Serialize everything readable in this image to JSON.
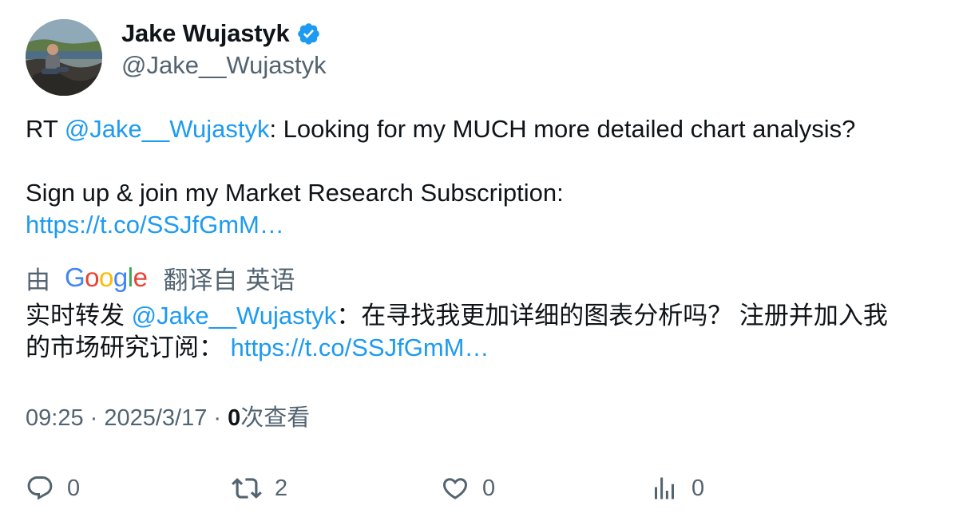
{
  "author": {
    "display_name": "Jake Wujastyk",
    "handle": "@Jake__Wujastyk",
    "verified": true
  },
  "tweet": {
    "original": {
      "prefix": "RT ",
      "mention": "@Jake__Wujastyk",
      "line1_rest": ": Looking for my MUCH more detailed chart analysis?",
      "line2": "Sign up & join my Market Research Subscription:",
      "link": "https://t.co/SSJfGmM…"
    },
    "translation": {
      "by_label": "由",
      "provider": "Google",
      "from_label": "翻译自",
      "language": "英语",
      "prefix": "实时转发 ",
      "mention": "@Jake__Wujastyk",
      "line1_rest": "：在寻找我更加详细的图表分析吗？ 注册并加入我",
      "line2": "的市场研究订阅： ",
      "link": "https://t.co/SSJfGmM…"
    }
  },
  "meta": {
    "time": "09:25",
    "separator": " · ",
    "date": "2025/3/17",
    "views_count": "0",
    "views_label": "次查看"
  },
  "actions": {
    "reply_count": "0",
    "retweet_count": "2",
    "like_count": "0",
    "views_count": "0"
  },
  "colors": {
    "link": "#1d9bf0",
    "secondary_text": "#536471",
    "primary_text": "#0f1419",
    "verified_badge": "#1d9bf0"
  },
  "icons": {
    "verified": "verified-badge-icon",
    "reply": "reply-icon",
    "retweet": "retweet-icon",
    "like": "heart-icon",
    "views": "analytics-icon"
  }
}
